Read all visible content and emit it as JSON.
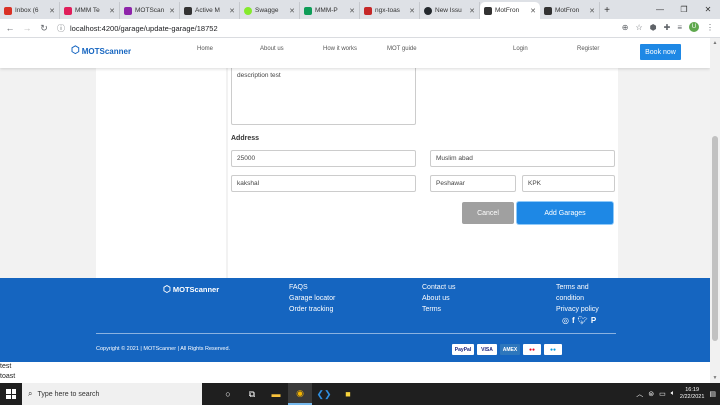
{
  "browser": {
    "tabs": [
      {
        "label": "Inbox (6",
        "color": "#d93025",
        "active": false
      },
      {
        "label": "MMM Te",
        "color": "#e01e5a",
        "active": false
      },
      {
        "label": "MOTScan",
        "color": "#8e24aa",
        "active": false
      },
      {
        "label": "Active M",
        "color": "#333333",
        "active": false
      },
      {
        "label": "Swagge",
        "color": "#85ea2d",
        "active": false
      },
      {
        "label": "MMM-P",
        "color": "#0f9d58",
        "active": false
      },
      {
        "label": "ngx-toas",
        "color": "#c62828",
        "active": false
      },
      {
        "label": "New Issu",
        "color": "#24292e",
        "active": false
      },
      {
        "label": "MotFron",
        "color": "#333333",
        "active": true
      },
      {
        "label": "MotFron",
        "color": "#333333",
        "active": false
      }
    ],
    "url": "localhost:4200/garage/update-garage/18752"
  },
  "header": {
    "logo": "MOTScanner",
    "nav": [
      "Home",
      "About us",
      "How it works",
      "MOT guide",
      "Login",
      "Register"
    ],
    "book_now": "Book now"
  },
  "form": {
    "description": "description test",
    "address_label": "Address",
    "fields": {
      "postcode": "25000",
      "area": "Muslim abad",
      "street": "kakshal",
      "city": "Peshawar",
      "province": "KPK"
    },
    "cancel_label": "Cancel",
    "add_label": "Add Garages"
  },
  "footer": {
    "logo": "MOTScanner",
    "col1": [
      "FAQS",
      "Garage locator",
      "Order tracking"
    ],
    "col2": [
      "Contact us",
      "About us",
      "Terms"
    ],
    "col3": [
      "Terms and",
      "condition",
      "Privacy policy"
    ],
    "social": [
      "instagram-icon",
      "facebook-icon",
      "twitter-icon",
      "pinterest-icon"
    ],
    "copyright": "Copyright © 2021 | MOTScanner | All Rights Reserved.",
    "payments": [
      "PayPal",
      "VISA",
      "AMEX",
      "MC",
      "Maestro"
    ]
  },
  "toasts": [
    "test",
    "toast"
  ],
  "taskbar": {
    "search_placeholder": "Type here to search",
    "time": "16:19",
    "date": "2/22/2021"
  },
  "colors": {
    "brand_blue": "#1565c0",
    "button_blue": "#1e88e5",
    "cancel_gray": "#a0a0a0"
  }
}
